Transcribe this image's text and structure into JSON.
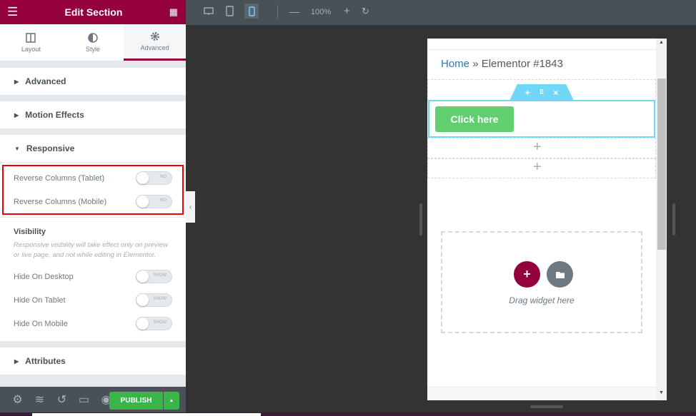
{
  "panel": {
    "title": "Edit Section",
    "tabs": [
      {
        "label": "Layout",
        "icon": "columns-icon"
      },
      {
        "label": "Style",
        "icon": "contrast-icon"
      },
      {
        "label": "Advanced",
        "icon": "gear-icon",
        "active": true
      }
    ],
    "sections": {
      "advanced": "Advanced",
      "motion": "Motion Effects",
      "responsive": "Responsive",
      "attributes": "Attributes"
    },
    "responsive": [
      {
        "label": "Reverse Columns (Tablet)",
        "state": "NO"
      },
      {
        "label": "Reverse Columns (Mobile)",
        "state": "NO"
      }
    ],
    "visibility": {
      "title": "Visibility",
      "note": "Responsive visibility will take effect only on preview or live page, and not while editing in Elementor.",
      "items": [
        {
          "label": "Hide On Desktop",
          "state": "SHOW"
        },
        {
          "label": "Hide On Tablet",
          "state": "SHOW"
        },
        {
          "label": "Hide On Mobile",
          "state": "SHOW"
        }
      ]
    },
    "footer": {
      "publish": "PUBLISH"
    }
  },
  "topbar": {
    "zoom": "100%",
    "active_device": "mobile"
  },
  "preview": {
    "crumb_home": "Home",
    "crumb_sep": "»",
    "crumb_page": "Elementor #1843",
    "button": "Click here",
    "drag_text": "Drag widget here"
  },
  "colors": {
    "brand": "#93003c",
    "publish": "#39b54a",
    "selection": "#71d7f7",
    "button": "#61ce70"
  }
}
